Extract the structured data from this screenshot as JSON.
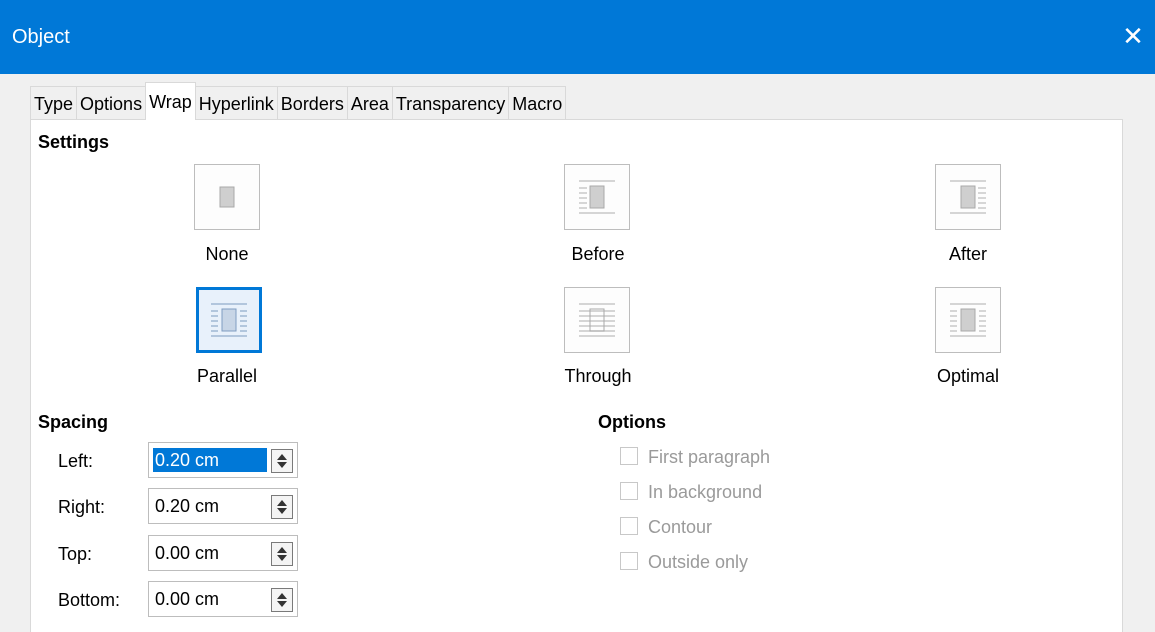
{
  "window": {
    "title": "Object",
    "close_icon": "close-icon"
  },
  "tabs": [
    "Type",
    "Options",
    "Wrap",
    "Hyperlink",
    "Borders",
    "Area",
    "Transparency",
    "Macro"
  ],
  "active_tab": "Wrap",
  "settings": {
    "heading": "Settings",
    "options": [
      {
        "label": "None",
        "icon": "wrap-none-icon",
        "selected": false
      },
      {
        "label": "Before",
        "icon": "wrap-before-icon",
        "selected": false
      },
      {
        "label": "After",
        "icon": "wrap-after-icon",
        "selected": false
      },
      {
        "label": "Parallel",
        "icon": "wrap-parallel-icon",
        "selected": true
      },
      {
        "label": "Through",
        "icon": "wrap-through-icon",
        "selected": false
      },
      {
        "label": "Optimal",
        "icon": "wrap-optimal-icon",
        "selected": false
      }
    ]
  },
  "spacing": {
    "heading": "Spacing",
    "fields": [
      {
        "label": "Left:",
        "value": "0.20 cm"
      },
      {
        "label": "Right:",
        "value": "0.20 cm"
      },
      {
        "label": "Top:",
        "value": "0.00 cm"
      },
      {
        "label": "Bottom:",
        "value": "0.00 cm"
      }
    ]
  },
  "options": {
    "heading": "Options",
    "checkboxes": [
      {
        "label": "First paragraph",
        "checked": false,
        "enabled": false
      },
      {
        "label": "In background",
        "checked": false,
        "enabled": false
      },
      {
        "label": "Contour",
        "checked": false,
        "enabled": false
      },
      {
        "label": "Outside only",
        "checked": false,
        "enabled": false
      }
    ]
  },
  "colors": {
    "accent": "#0078d7",
    "disabled_text": "#9a9a9a"
  }
}
